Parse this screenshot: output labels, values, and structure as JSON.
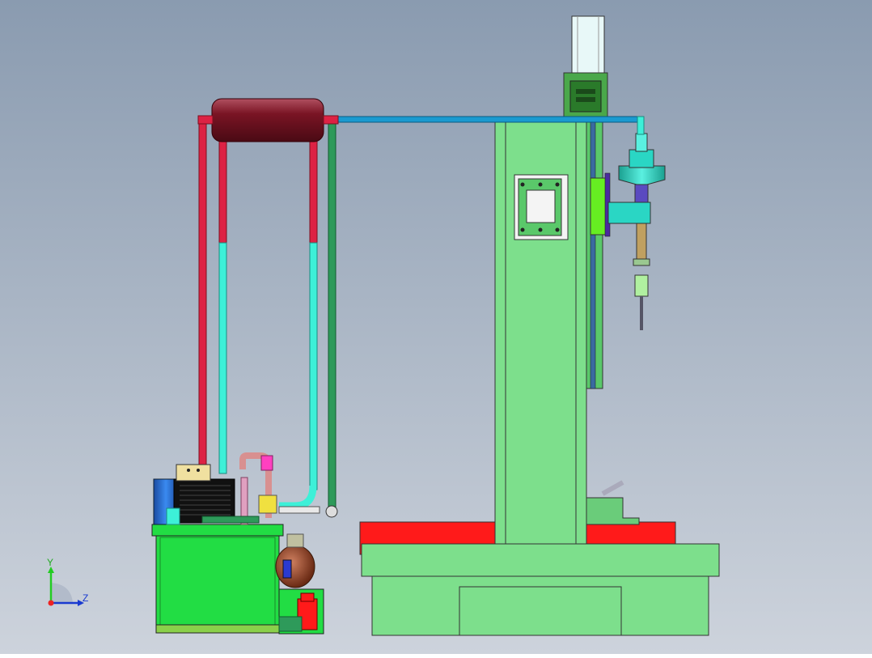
{
  "viewport": {
    "background_top": "#8a9bb0",
    "background_bottom": "#cdd3dc"
  },
  "triad": {
    "y_label": "Y",
    "z_label": "Z"
  },
  "colors": {
    "machine_body": "#7ddf8c",
    "table_red": "#ff1a1a",
    "tank_green": "#22dd44",
    "cooler_drum": "#7a1424",
    "pipe_red": "#dd2244",
    "pipe_cyan": "#3df0d8",
    "pipe_dark_green": "#2e9a5a",
    "pipe_blue": "#1a9ad0",
    "motor_blue": "#2a6ad0",
    "spindle_cyan": "#2ad6c4",
    "accumulator_brown": "#9a4a2a"
  }
}
